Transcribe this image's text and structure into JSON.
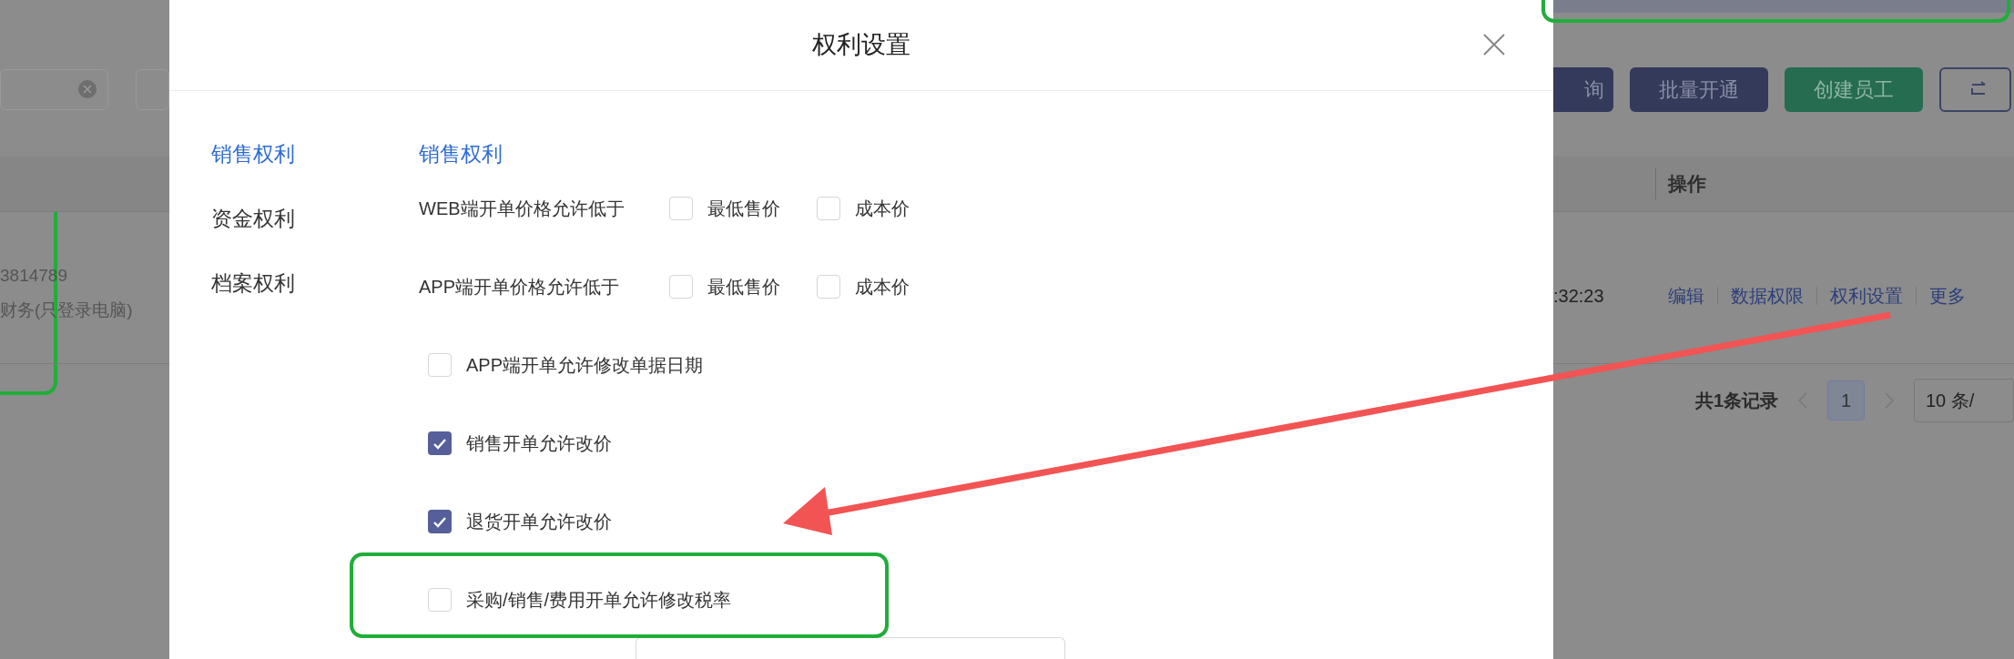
{
  "background": {
    "toolbar_buttons": [
      {
        "kind": "primary",
        "label": "询"
      },
      {
        "kind": "primary",
        "label": "批量开通"
      },
      {
        "kind": "success",
        "label": "创建员工"
      },
      {
        "kind": "outline"
      }
    ],
    "table": {
      "columns": [
        {
          "label": "操作"
        }
      ],
      "row": {
        "cells": [
          "3814789",
          "财务(只登录电脑)"
        ],
        "time": ":32:23",
        "actions": [
          "编辑",
          "数据权限",
          "权利设置",
          "更多"
        ]
      }
    },
    "pagination": {
      "total": "共1条记录",
      "pages": [
        {
          "label": "1",
          "selected": true
        }
      ],
      "page_size": "10 条/"
    }
  },
  "dialog": {
    "title": "权利设置",
    "nav": [
      {
        "label": "销售权利",
        "selected": true
      },
      {
        "label": "资金权利",
        "selected": false
      },
      {
        "label": "档案权利",
        "selected": false
      }
    ],
    "section_title": "销售权利",
    "rows": [
      {
        "kind": "options",
        "label": "WEB端开单价格允许低于",
        "options": [
          {
            "label": "最低售价",
            "checked": false
          },
          {
            "label": "成本价",
            "checked": false
          }
        ]
      },
      {
        "kind": "options",
        "label": "APP端开单价格允许低于",
        "options": [
          {
            "label": "最低售价",
            "checked": false
          },
          {
            "label": "成本价",
            "checked": false
          }
        ]
      },
      {
        "kind": "checkbox",
        "label": "APP端开单允许修改单据日期",
        "checked": false
      },
      {
        "kind": "checkbox",
        "label": "销售开单允许改价",
        "checked": true
      },
      {
        "kind": "checkbox",
        "label": "退货开单允许改价",
        "checked": true
      },
      {
        "kind": "checkbox",
        "label": "采购/销售/费用开单允许修改税率",
        "checked": false
      }
    ]
  }
}
